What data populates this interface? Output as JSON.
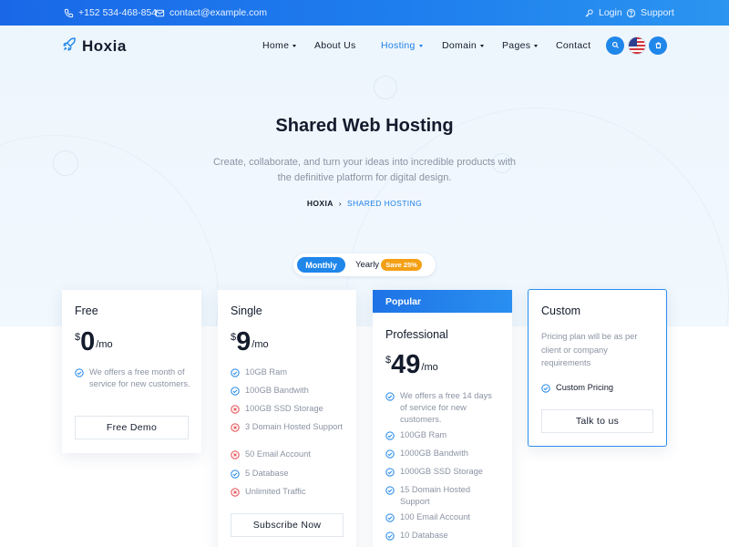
{
  "topbar": {
    "phone": "+152 534-468-854",
    "email": "contact@example.com",
    "login": "Login",
    "support": "Support"
  },
  "brand": {
    "name": "Hoxia"
  },
  "nav": {
    "items": [
      {
        "label": "Home",
        "dropdown": true
      },
      {
        "label": "About Us",
        "dropdown": false
      },
      {
        "label": "Hosting",
        "dropdown": true,
        "active": true
      },
      {
        "label": "Domain",
        "dropdown": true
      },
      {
        "label": "Pages",
        "dropdown": true
      },
      {
        "label": "Contact",
        "dropdown": false
      }
    ],
    "icons": [
      "search-icon",
      "us-flag-icon",
      "cart-icon"
    ]
  },
  "hero": {
    "title": "Shared Web Hosting",
    "subtitle": "Create, collaborate, and turn your ideas into incredible products with the definitive platform for digital design.",
    "breadcrumb": {
      "home": "HOXIA",
      "separator": "›",
      "current": "SHARED HOSTING"
    }
  },
  "billing_toggle": {
    "monthly": "Monthly",
    "yearly": "Yearly",
    "save_badge": "Save 25%",
    "selected": "Monthly"
  },
  "plans": {
    "free": {
      "name": "Free",
      "currency": "$",
      "amount": "0",
      "period": "/mo",
      "features": [
        {
          "text": "We offers a free month of service for new customers.",
          "included": true
        }
      ],
      "button": "Free Demo"
    },
    "single": {
      "name": "Single",
      "currency": "$",
      "amount": "9",
      "period": "/mo",
      "features": [
        {
          "text": "10GB Ram",
          "included": true
        },
        {
          "text": "100GB Bandwith",
          "included": true
        },
        {
          "text": "100GB SSD Storage",
          "included": false
        },
        {
          "text": "3 Domain Hosted Support",
          "included": false
        },
        {
          "text": "50 Email Account",
          "included": false
        },
        {
          "text": "5 Database",
          "included": true
        },
        {
          "text": "Unlimited Traffic",
          "included": false
        }
      ],
      "button": "Subscribe Now"
    },
    "professional": {
      "badge": "Popular",
      "name": "Professional",
      "currency": "$",
      "amount": "49",
      "period": "/mo",
      "features": [
        {
          "text": "We offers a free 14 days of service for new customers.",
          "included": true
        },
        {
          "text": "100GB Ram",
          "included": true
        },
        {
          "text": "1000GB Bandwith",
          "included": true
        },
        {
          "text": "1000GB SSD Storage",
          "included": true
        },
        {
          "text": "15 Domain Hosted Support",
          "included": true
        },
        {
          "text": "100 Email Account",
          "included": true
        },
        {
          "text": "10 Database",
          "included": true
        }
      ]
    },
    "custom": {
      "name": "Custom",
      "description": "Pricing plan will be as per client or company requirements",
      "feature": "Custom Pricing",
      "button": "Talk to us"
    }
  },
  "colors": {
    "accent": "#1f86ea",
    "check": "#1f86ea",
    "cross": "#e5484d",
    "badge": "#f4a015",
    "heading": "#131b2c",
    "muted": "#8b93a3"
  }
}
